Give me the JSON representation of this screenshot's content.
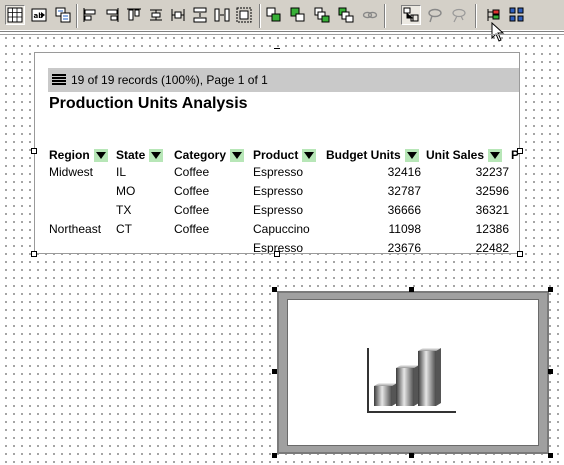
{
  "toolbar": {
    "icons": [
      "grid-icon",
      "tab-order-icon",
      "layers-icon",
      "align-left-icon",
      "align-right-icon",
      "align-top-icon",
      "align-middle-icon",
      "align-center-icon",
      "distribute-vertical-icon",
      "distribute-horizontal-icon",
      "group-icon",
      "bring-forward-icon",
      "send-backward-icon",
      "bring-to-front-icon",
      "send-to-back-icon",
      "link-chain-icon",
      "lasso-icon",
      "lasso-hint-icon",
      "format-tree-icon",
      "field-list-icon"
    ]
  },
  "report": {
    "status_text": "19 of 19 records (100%), Page 1 of 1",
    "title": "Production Units Analysis",
    "columns": [
      "Region",
      "State",
      "Category",
      "Product",
      "Budget Units",
      "Unit Sales",
      "P"
    ],
    "rows": [
      {
        "region": "Midwest",
        "state": "IL",
        "category": "Coffee",
        "product": "Espresso",
        "budget_units": "32416",
        "unit_sales": "32237"
      },
      {
        "region": "",
        "state": "MO",
        "category": "Coffee",
        "product": "Espresso",
        "budget_units": "32787",
        "unit_sales": "32596"
      },
      {
        "region": "",
        "state": "TX",
        "category": "Coffee",
        "product": "Espresso",
        "budget_units": "36666",
        "unit_sales": "36321"
      },
      {
        "region": "Northeast",
        "state": "CT",
        "category": "Coffee",
        "product": "Capuccino",
        "budget_units": "11098",
        "unit_sales": "12386"
      },
      {
        "region": "",
        "state": "",
        "category": "",
        "product": "Espresso",
        "budget_units": "23676",
        "unit_sales": "22482"
      }
    ]
  },
  "chart_component": {
    "icon": "bar-chart-icon"
  },
  "colors": {
    "toolbar_bg": "#d4d0c8",
    "status_bar_bg": "#c9c9c9",
    "sort_button_bg": "#b7e6b7"
  }
}
